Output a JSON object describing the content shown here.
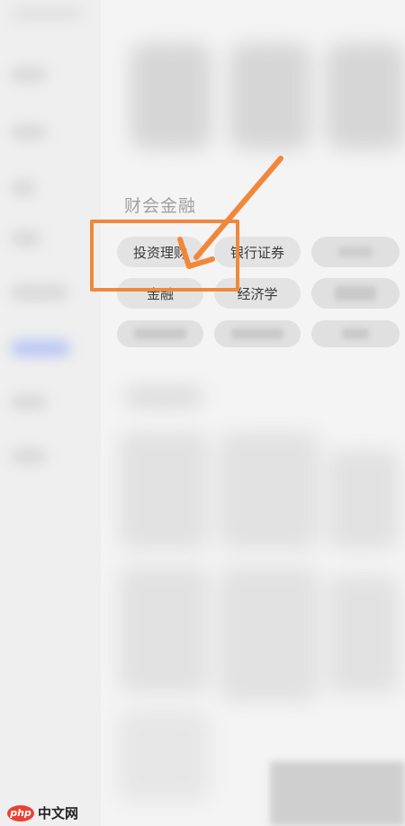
{
  "section": {
    "title": "财会金融",
    "chips": [
      {
        "label": "投资理财"
      },
      {
        "label": "银行证券"
      },
      {
        "label": "金融"
      },
      {
        "label": "经济学"
      }
    ]
  },
  "watermark": {
    "logo": "php",
    "text": "中文网"
  },
  "colors": {
    "highlight": "#f0883c",
    "chip_bg": "#e3e3e3",
    "sidebar_active": "#b9c6f4",
    "watermark_logo": "#e94234"
  },
  "icons": [
    "arrow-icon"
  ]
}
